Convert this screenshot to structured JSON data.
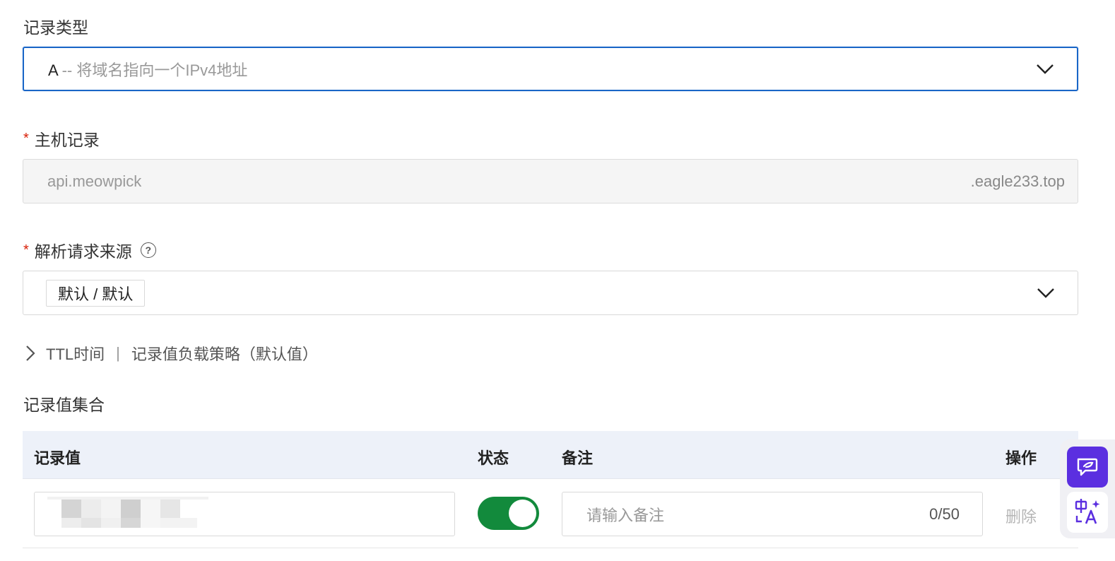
{
  "record_type": {
    "label": "记录类型",
    "value_code": "A",
    "value_desc": " -- 将域名指向一个IPv4地址"
  },
  "host_record": {
    "label": "主机记录",
    "required_mark": "*",
    "value": "api.meowpick",
    "suffix": ".eagle233.top"
  },
  "resolve_source": {
    "label": "解析请求来源",
    "required_mark": "*",
    "help_icon": "question-circle-icon",
    "tag": "默认 / 默认"
  },
  "advanced": {
    "ttl_label": "TTL时间",
    "separator": "|",
    "strategy_label": "记录值负载策略（默认值）"
  },
  "record_values": {
    "label": "记录值集合",
    "columns": [
      "记录值",
      "状态",
      "备注",
      "操作"
    ],
    "rows": [
      {
        "status_on": true,
        "note_placeholder": "请输入备注",
        "note_count": "0/50",
        "action": "删除"
      }
    ]
  },
  "colors": {
    "focus_border": "#1966c7",
    "toggle_on": "#128a3c",
    "required": "#d81e06",
    "table_header_bg": "#edf1f9",
    "assistant_bg": "#5b2fe0"
  }
}
